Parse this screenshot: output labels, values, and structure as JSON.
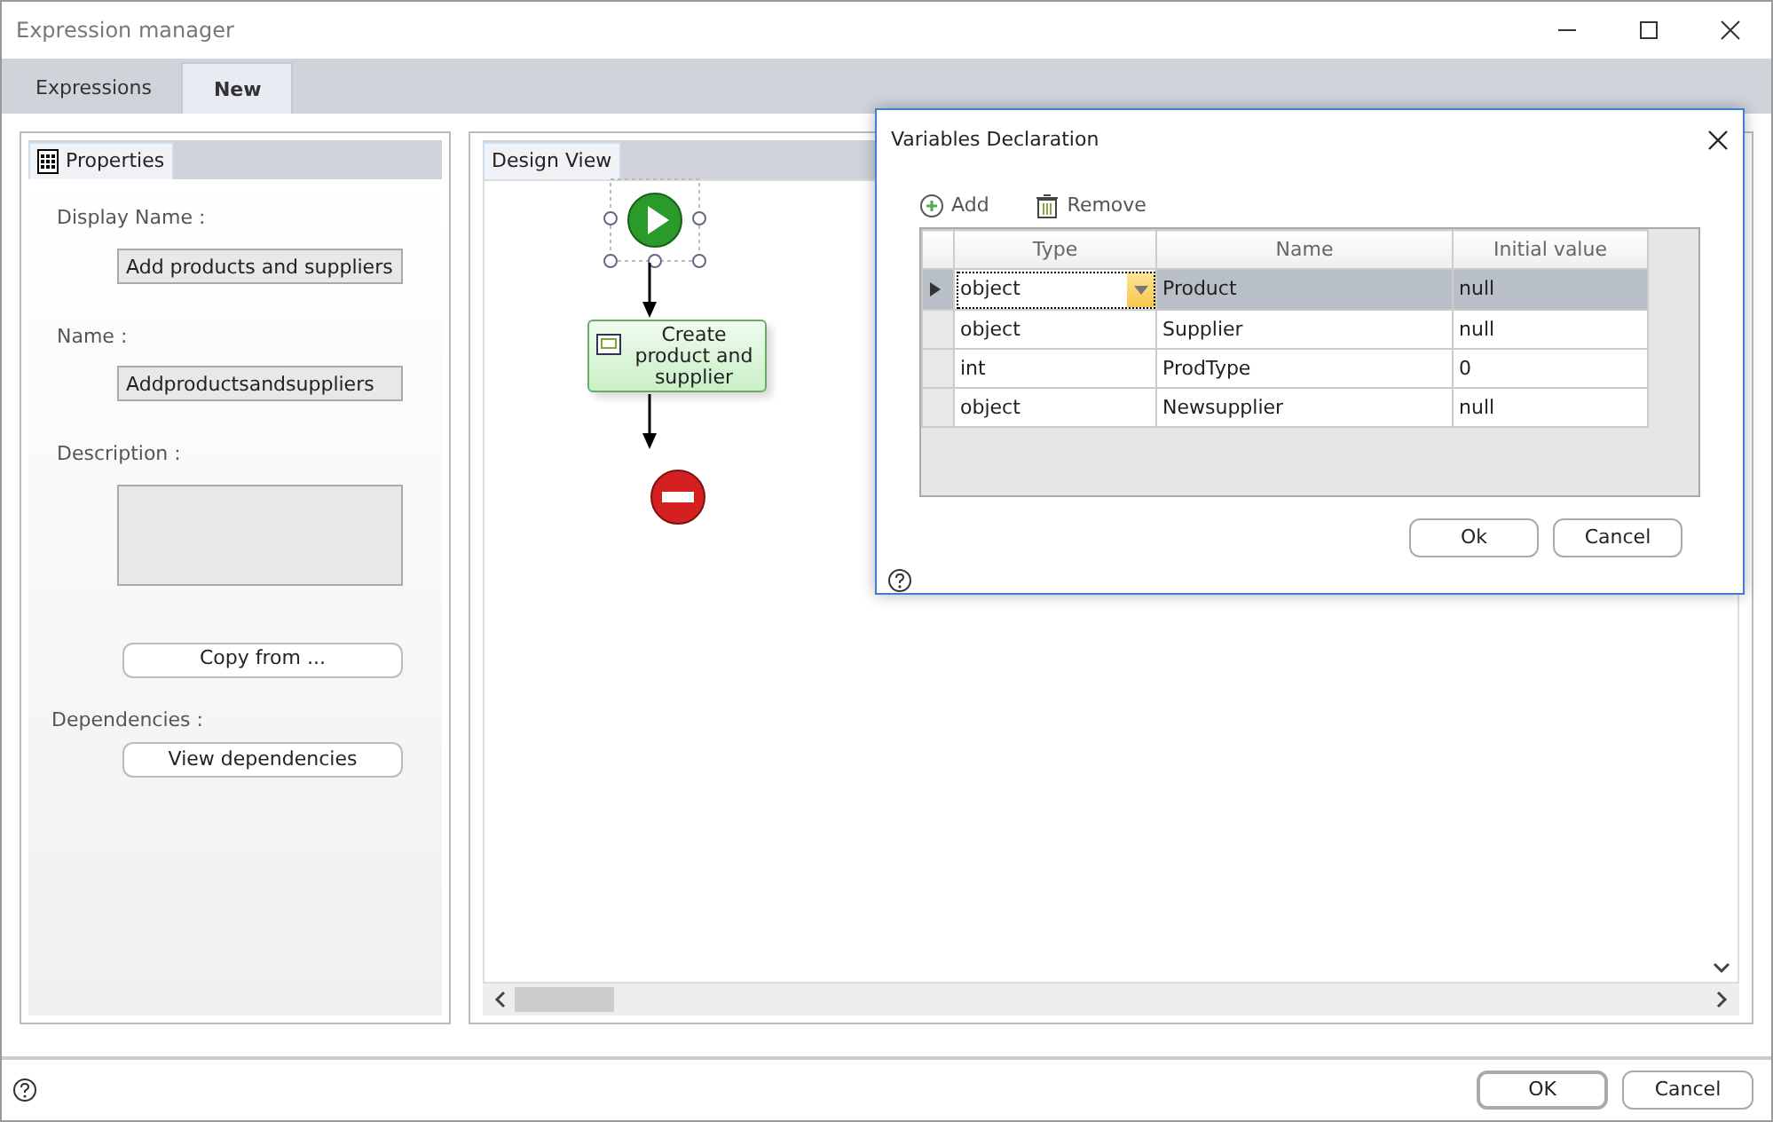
{
  "window": {
    "title": "Expression manager"
  },
  "tabs": [
    {
      "label": "Expressions",
      "selected": false
    },
    {
      "label": "New",
      "selected": true
    }
  ],
  "properties_panel": {
    "tab": "Properties",
    "fields": [
      {
        "kind": "text",
        "label": "Display Name :",
        "value": "Add products and suppliers"
      },
      {
        "kind": "text",
        "label": "Name :",
        "value": "Addproductsandsuppliers"
      },
      {
        "kind": "area",
        "label": "Description :"
      }
    ],
    "copy_button": "Copy from ...",
    "dependencies_label": "Dependencies :",
    "dependencies_button": "View dependencies"
  },
  "design_view": {
    "tab": "Design View",
    "nodes": [
      {
        "kind": "start",
        "selected": true
      },
      {
        "kind": "activity",
        "label": "Create product and supplier",
        "selected": false
      },
      {
        "kind": "end",
        "selected": false
      }
    ]
  },
  "dialog": {
    "title": "Variables Declaration",
    "toolbar": [
      "Add",
      "Remove"
    ],
    "columns": [
      "Type",
      "Name",
      "Initial value"
    ],
    "rows": [
      {
        "type": "object",
        "name": "Product",
        "initial_value": "null",
        "selected": true
      },
      {
        "type": "object",
        "name": "Supplier",
        "initial_value": "null",
        "selected": false
      },
      {
        "type": "int",
        "name": "ProdType",
        "initial_value": "0",
        "selected": false
      },
      {
        "type": "object",
        "name": "Newsupplier",
        "initial_value": "null",
        "selected": false
      }
    ],
    "buttons": [
      "Ok",
      "Cancel"
    ]
  },
  "footer": {
    "buttons": [
      "OK",
      "Cancel"
    ]
  }
}
